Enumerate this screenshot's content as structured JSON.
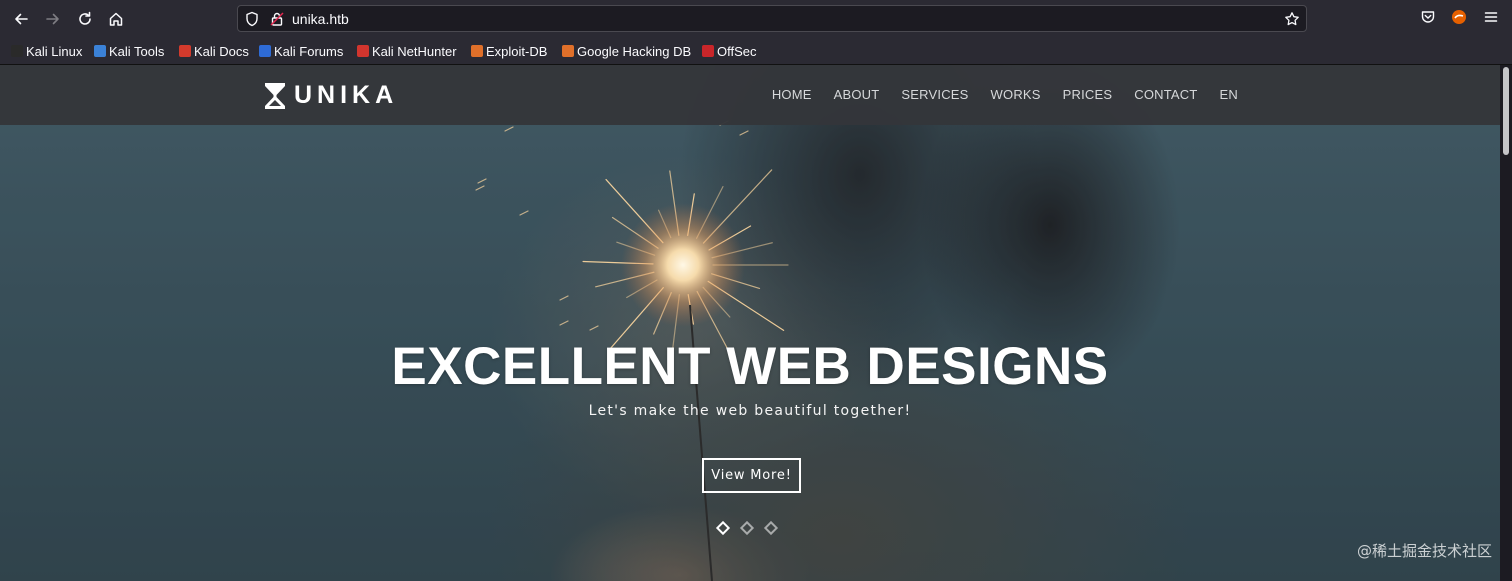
{
  "browser": {
    "url": "unika.htb",
    "bookmarks": [
      {
        "label": "Kali Linux",
        "color": "#2a2a2a"
      },
      {
        "label": "Kali Tools",
        "color": "#3b82d8"
      },
      {
        "label": "Kali Docs",
        "color": "#d33a2c"
      },
      {
        "label": "Kali Forums",
        "color": "#2e6bd6"
      },
      {
        "label": "Kali NetHunter",
        "color": "#d2352e"
      },
      {
        "label": "Exploit-DB",
        "color": "#e0702a"
      },
      {
        "label": "Google Hacking DB",
        "color": "#e0702a"
      },
      {
        "label": "OffSec",
        "color": "#c9262a"
      }
    ]
  },
  "site": {
    "logo": "UNIKA",
    "menu": [
      "HOME",
      "ABOUT",
      "SERVICES",
      "WORKS",
      "PRICES",
      "CONTACT",
      "EN"
    ],
    "hero": {
      "headline": "EXCELLENT WEB DESIGNS",
      "subline": "Let's make the web beautiful together!",
      "cta": "View More!",
      "slide_count": 3,
      "active_slide": 1
    }
  },
  "watermark": "@稀土掘金技术社区"
}
